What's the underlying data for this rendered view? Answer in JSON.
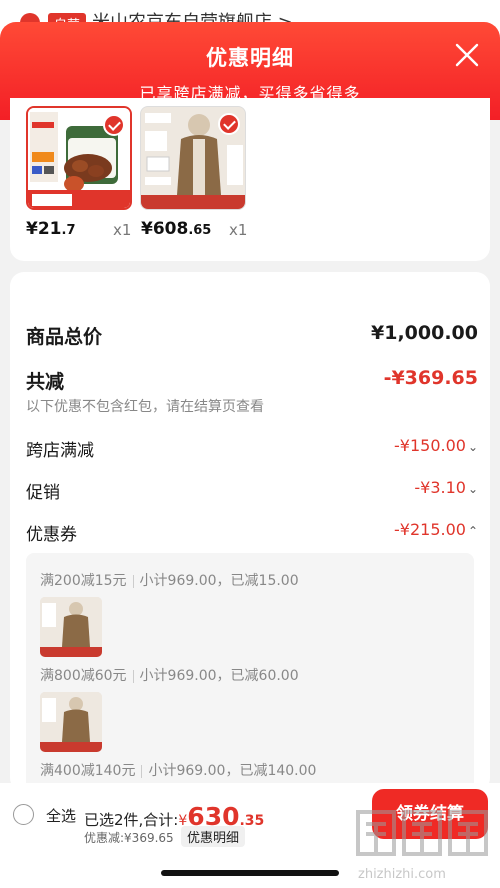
{
  "background": {
    "store_badge": "自营",
    "store_name": "米山农京东自营旗舰店 >"
  },
  "header": {
    "title": "优惠明细",
    "subtitle": "已享跨店满减，买得多省得多"
  },
  "products": [
    {
      "price_int": "¥21",
      "price_dec": ".7",
      "qty": "x1"
    },
    {
      "price_int": "¥608",
      "price_dec": ".65",
      "qty": "x1"
    }
  ],
  "summary": {
    "total_label": "商品总价",
    "total_value": "¥1,000.00",
    "reduce_label": "共减",
    "reduce_value": "-¥369.65",
    "note": "以下优惠不包含红包，请在结算页查看",
    "cross_store_label": "跨店满减",
    "cross_store_value": "-¥150.00",
    "promo_label": "促销",
    "promo_value": "-¥3.10",
    "coupon_label": "优惠券",
    "coupon_value": "-¥215.00"
  },
  "coupons": [
    {
      "rule": "满200减15元",
      "detail": "小计969.00，已减15.00"
    },
    {
      "rule": "满800减60元",
      "detail": "小计969.00，已减60.00"
    },
    {
      "rule": "满400减140元",
      "detail": "小计969.00，已减140.00"
    }
  ],
  "bottom": {
    "select_all": "全选",
    "selected_text": "已选2件,合计:",
    "pay_symbol": "¥",
    "pay_int": "630",
    "pay_dec": ".35",
    "discount_text": "优惠减:¥369.65",
    "detail_button": "优惠明细",
    "checkout": "领券结算",
    "watermark": "zhizhizhi.com"
  },
  "colors": {
    "accent_red": "#e0352b",
    "header_red": "#f31f26"
  }
}
